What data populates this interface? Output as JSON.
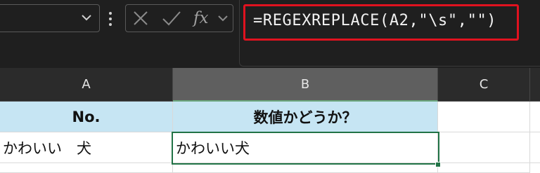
{
  "formula_bar": {
    "formula": "=REGEXREPLACE(A2,\"\\s\",\"\")",
    "fx_label": "fx",
    "icons": [
      "chevron-down-icon",
      "more-vertical-icon",
      "cancel-x-icon",
      "confirm-check-icon",
      "function-fx-icon",
      "chevron-down-icon"
    ],
    "highlight_color": "#e0121f"
  },
  "columns": [
    "A",
    "B",
    "C"
  ],
  "rows": [
    {
      "A": "No.",
      "B": "数値かどうか？",
      "C": ""
    },
    {
      "A": "かわいい　犬",
      "B": "かわいい犬",
      "C": ""
    }
  ],
  "colors": {
    "header_fill": "#c6e5f3",
    "active_border": "#217346",
    "selected_column_header": "#5f5f5f"
  }
}
